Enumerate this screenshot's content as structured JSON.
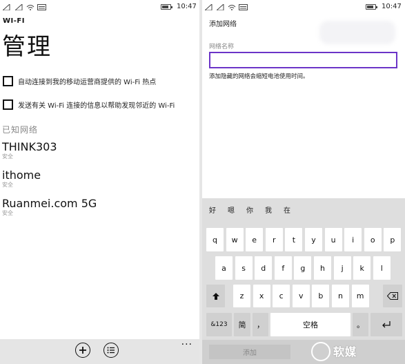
{
  "status": {
    "time": "10:47"
  },
  "left": {
    "app_label": "WI-FI",
    "title": "管理",
    "options": [
      {
        "label": "自动连接到我的移动运营商提供的 Wi-Fi 热点",
        "checked": false
      },
      {
        "label": "发送有关 Wi-Fi 连接的信息以帮助发现邻近的 Wi-Fi",
        "checked": false
      }
    ],
    "known_networks_heading": "已知网络",
    "networks": [
      {
        "name": "THINK303",
        "security": "安全"
      },
      {
        "name": "ithome",
        "security": "安全"
      },
      {
        "name": "Ruanmei.com 5G",
        "security": "安全"
      }
    ],
    "appbar": {
      "add_icon": "plus-circle-icon",
      "list_icon": "list-circle-icon",
      "more": "···"
    }
  },
  "right": {
    "title": "添加网络",
    "field_label": "网络名称",
    "field_value": "",
    "hint": "添加隐藏的网络会缩短电池使用时间。",
    "suggestions": [
      "好",
      "嗯",
      "你",
      "我",
      "在"
    ],
    "keyboard": {
      "row1": [
        "q",
        "w",
        "e",
        "r",
        "t",
        "y",
        "u",
        "i",
        "o",
        "p"
      ],
      "row2": [
        "a",
        "s",
        "d",
        "f",
        "g",
        "h",
        "j",
        "k",
        "l"
      ],
      "row3": [
        "z",
        "x",
        "c",
        "v",
        "b",
        "n",
        "m"
      ],
      "shift": "🡅",
      "backspace": "⌫",
      "symbols": "&123",
      "simplified": "简",
      "space": "空格",
      "comma": "，",
      "period": "。",
      "enter": "↵"
    },
    "add_button": "添加",
    "watermark": "软媒"
  },
  "colors": {
    "accent": "#6b33c7",
    "appbar": "#e5e5e5",
    "keyboard": "#dedede"
  }
}
